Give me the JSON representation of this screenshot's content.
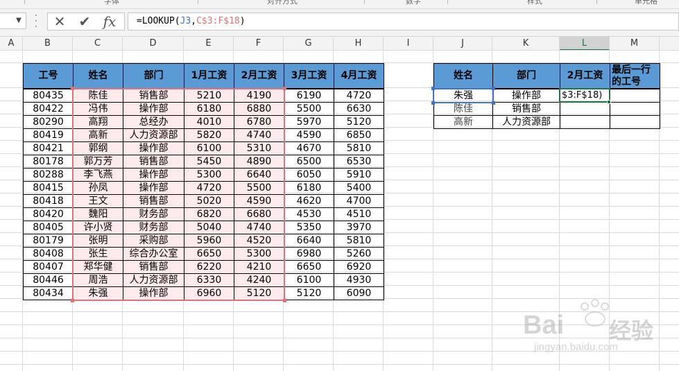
{
  "ribbon": {
    "fragments": [
      "字体",
      "对齐方式",
      "数字",
      "样式",
      "单元格"
    ]
  },
  "formula_bar": {
    "cancel_icon": "✕",
    "enter_icon": "✔",
    "fx_label": "fx",
    "formula_prefix": "=LOOKUP(",
    "formula_arg1": "J3",
    "formula_sep": ",",
    "formula_arg2": "C$3:F$18",
    "formula_suffix": ")",
    "arg1_color": "#4472c4",
    "arg2_color": "#e0707a"
  },
  "columns": [
    "A",
    "B",
    "C",
    "D",
    "E",
    "F",
    "G",
    "H",
    "I",
    "J",
    "K",
    "L",
    "M"
  ],
  "selected_column": "L",
  "table1": {
    "headers": [
      "工号",
      "姓名",
      "部门",
      "1月工资",
      "2月工资",
      "3月工资",
      "4月工资"
    ],
    "rows": [
      [
        "80435",
        "陈佳",
        "销售部",
        "5210",
        "4190",
        "6190",
        "4720"
      ],
      [
        "80422",
        "冯伟",
        "操作部",
        "6180",
        "6880",
        "5500",
        "6630"
      ],
      [
        "80290",
        "高翔",
        "总经办",
        "4010",
        "6780",
        "5970",
        "5120"
      ],
      [
        "80419",
        "高新",
        "人力资源部",
        "5820",
        "4740",
        "4590",
        "6850"
      ],
      [
        "80421",
        "郭纲",
        "操作部",
        "6100",
        "5310",
        "4670",
        "5810"
      ],
      [
        "80178",
        "郭万芳",
        "销售部",
        "5450",
        "4890",
        "6500",
        "6530"
      ],
      [
        "80288",
        "李飞燕",
        "操作部",
        "5300",
        "6640",
        "6050",
        "5910"
      ],
      [
        "80415",
        "孙凤",
        "操作部",
        "4720",
        "5500",
        "6180",
        "5400"
      ],
      [
        "80418",
        "王文",
        "销售部",
        "5020",
        "4590",
        "4620",
        "4700"
      ],
      [
        "80420",
        "魏阳",
        "财务部",
        "6820",
        "6680",
        "4530",
        "4510"
      ],
      [
        "80405",
        "许小贤",
        "财务部",
        "5040",
        "4740",
        "5350",
        "3970"
      ],
      [
        "80179",
        "张明",
        "采购部",
        "5960",
        "4520",
        "6640",
        "5810"
      ],
      [
        "80408",
        "张生",
        "综合办公室",
        "6650",
        "5300",
        "6980",
        "5260"
      ],
      [
        "80407",
        "郑华健",
        "销售部",
        "6220",
        "4210",
        "6650",
        "6920"
      ],
      [
        "80446",
        "周浩",
        "人力资源部",
        "6330",
        "4240",
        "6100",
        "4930"
      ],
      [
        "80434",
        "朱强",
        "操作部",
        "6960",
        "5120",
        "5120",
        "6090"
      ]
    ]
  },
  "table2": {
    "headers": [
      "姓名",
      "部门",
      "2月工资",
      "最后一行的工号"
    ],
    "rows": [
      [
        "朱强",
        "操作部",
        "$3:F$18)",
        ""
      ],
      [
        "陈佳",
        "销售部",
        "",
        ""
      ],
      [
        "高新",
        "人力资源部",
        "",
        ""
      ]
    ]
  },
  "watermark": {
    "brand": "Bai",
    "brand_tail": "经验",
    "url": "jingyan.baidu.com"
  }
}
